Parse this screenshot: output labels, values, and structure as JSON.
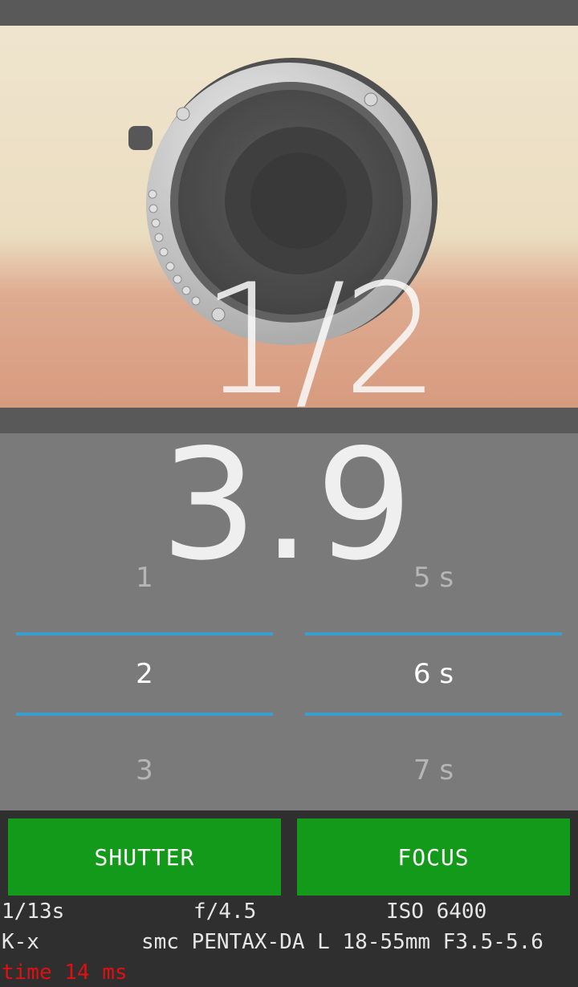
{
  "preview": {
    "overlay_value": "1/2",
    "image_subject": "camera-lens-rear-mount"
  },
  "selector": {
    "big_value": "3.9",
    "left_picker": {
      "prev": "1",
      "current": "2",
      "next": "3"
    },
    "right_picker": {
      "prev": "5 s",
      "current": "6 s",
      "next": "7 s"
    },
    "accent_color": "#3a9fd0"
  },
  "buttons": {
    "shutter_label": "SHUTTER",
    "focus_label": "FOCUS",
    "color": "#149a1a"
  },
  "status": {
    "shutter_speed": "1/13s",
    "aperture": "f/4.5",
    "iso": "ISO 6400",
    "camera_model": "K-x",
    "lens": "smc PENTAX-DA L 18-55mm F3.5-5.6",
    "timing": "time 14 ms",
    "timing_color": "#e01010"
  }
}
